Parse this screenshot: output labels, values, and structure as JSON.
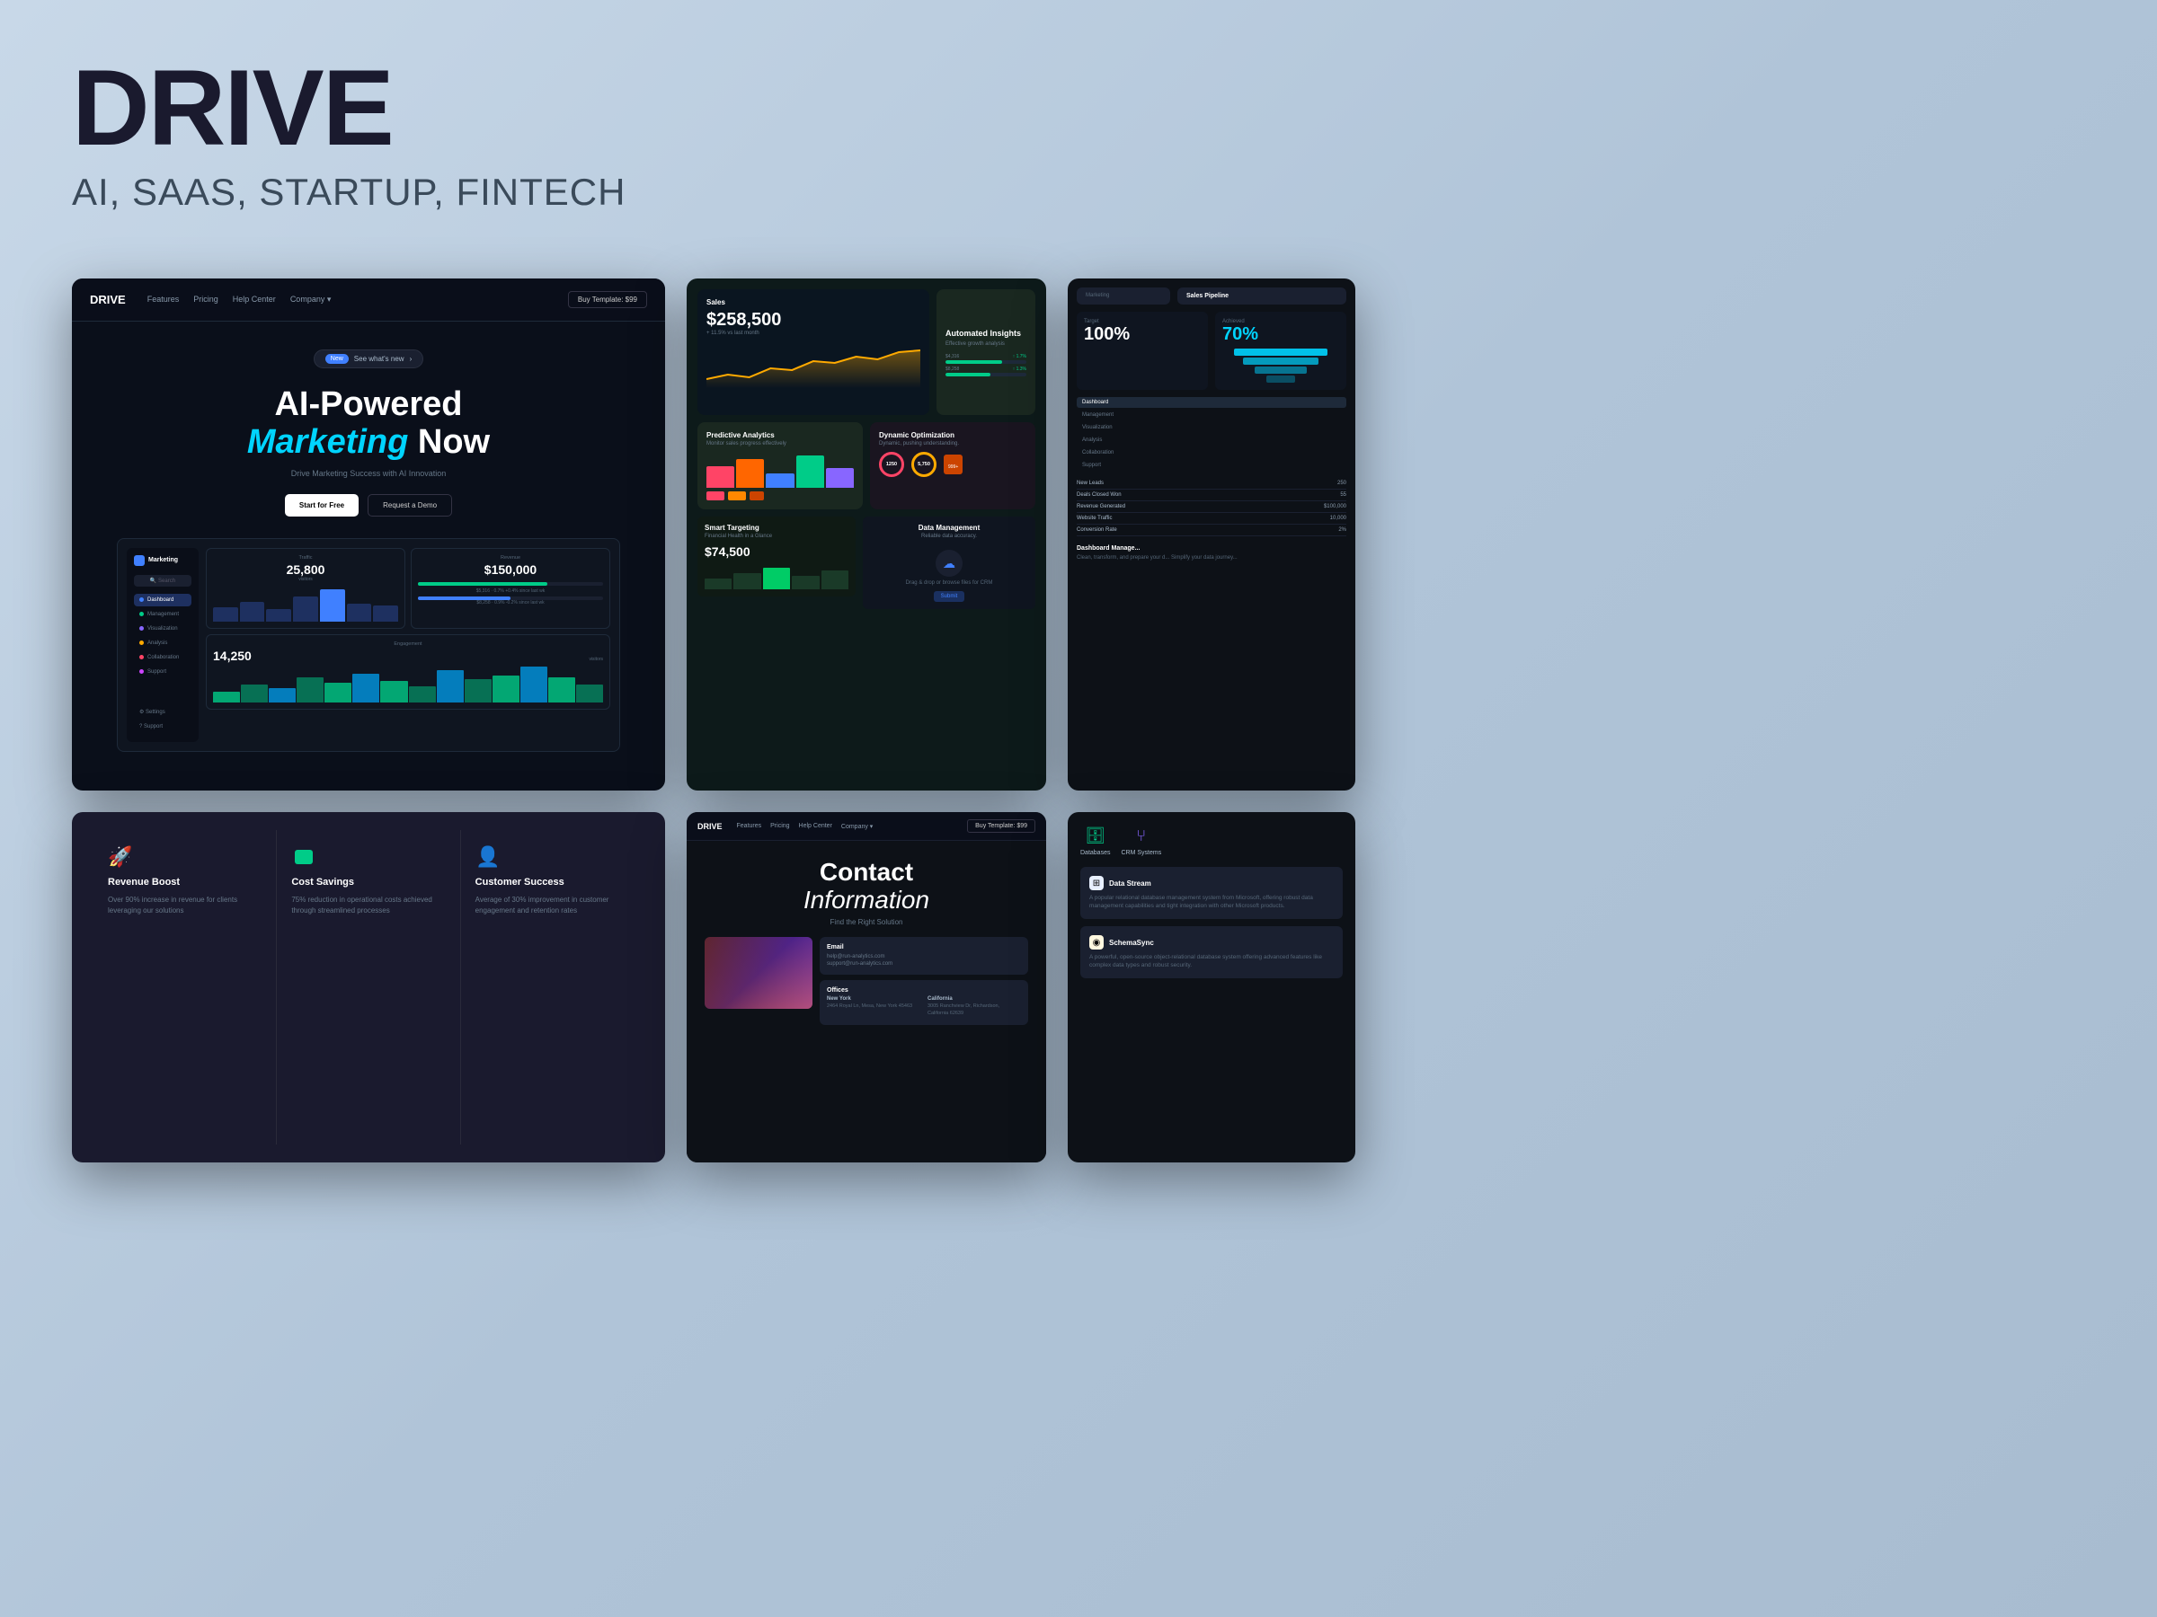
{
  "header": {
    "title": "DRIVE",
    "subtitle": "AI, SAAS, STARTUP, FINTECH"
  },
  "hero_card": {
    "logo": "DRIVE",
    "nav_links": [
      "Features",
      "Pricing",
      "Help Center",
      "Company"
    ],
    "buy_btn": "Buy Template: $99",
    "badge_new": "New",
    "badge_text": "See what's new",
    "heading_line1": "AI-Powered",
    "heading_line2": "Marketing Now",
    "subtext": "Drive Marketing Success with AI Innovation",
    "btn_primary": "Start for Free",
    "btn_secondary": "Request a Demo",
    "dashboard": {
      "logo": "D",
      "logo_text": "Marketing",
      "search_placeholder": "Search",
      "nav_items": [
        "Dashboard",
        "Management",
        "Visualization",
        "Analysis",
        "Collaboration",
        "Support"
      ],
      "traffic_label": "Traffic",
      "traffic_value": "25,800",
      "traffic_sub": "visitors",
      "revenue_label": "Revenue",
      "revenue_value": "$150,000",
      "engagement_label": "Engagement",
      "engagement_value": "14,250",
      "engagement_sub": "visitors"
    }
  },
  "analytics_card": {
    "sales_title": "Sales",
    "sales_value": "$258,500",
    "sales_sub": "+ 11.5% vs last month",
    "insights_title": "Automated Insights",
    "insights_sub": "Effective growth analysis",
    "insights_bars": [
      {
        "label": "$4,316",
        "pct": 70,
        "trend": "1.7% vs last week"
      },
      {
        "label": "$8,258",
        "pct": 55,
        "trend": "1.3% vs last week"
      }
    ],
    "predictive_title": "Predictive Analytics",
    "predictive_sub": "Monitor sales progress effectively",
    "dynamic_title": "Dynamic Optimization",
    "dynamic_sub": "Dynamic, pushing understanding.",
    "data_mgmt_title": "Data Management",
    "data_mgmt_sub": "Reliable data accuracy.",
    "smart_targeting_title": "Smart Targeting",
    "smart_targeting_sub": "Financial Health in a Glance",
    "smart_targeting_value": "$74,500",
    "upload_title": "Upload Files",
    "upload_sub": "Drag & drop or browse files for CRM"
  },
  "pipeline_card": {
    "marketing_label": "Marketing",
    "sales_pipeline_label": "Sales Pipeline",
    "pct_left": "100%",
    "pct_right": "70%",
    "nav_items": [
      "Dashboard",
      "Management",
      "Visualization",
      "Analysis",
      "Collaboration",
      "Support"
    ],
    "table_rows": [
      {
        "label": "New Leads",
        "value": "250"
      },
      {
        "label": "Deals Closed Won",
        "value": "55"
      },
      {
        "label": "Revenue Generated",
        "value": "$100,000"
      },
      {
        "label": "Website Traffic",
        "value": "10,000"
      },
      {
        "label": "Conversion Rate",
        "value": "2%"
      }
    ],
    "bottom_label": "Dashboard    Manage...",
    "bottom_sub": "Clean, transform, and prepare your d... Simplify your data journey..."
  },
  "contact_card": {
    "logo": "DRIVE",
    "nav_links": [
      "Features",
      "Pricing",
      "Help Center",
      "Company"
    ],
    "buy_btn": "Buy Template: $99",
    "heading": "Contact",
    "heading_italic": "Information",
    "sub": "Find the Right Solution",
    "email_label": "Email",
    "email_values": [
      "help@run-analytics.com",
      "support@run-analytics.com"
    ],
    "offices_label": "Offices",
    "office1_city": "New York",
    "office1_address": "2464 Royal Ln, Mesa, New York 45463",
    "office2_city": "California",
    "office2_address": "3005 Ranchview Dr, Richardson, California 62639"
  },
  "features_card": {
    "features": [
      {
        "icon": "rocket",
        "title": "Revenue Boost",
        "desc": "Over 90% increase in revenue for clients leveraging our solutions"
      },
      {
        "icon": "wallet",
        "title": "Cost Savings",
        "desc": "75% reduction in operational costs achieved through streamlined processes"
      },
      {
        "icon": "user",
        "title": "Customer Success",
        "desc": "Average of 30% improvement in customer engagement and retention rates"
      }
    ]
  },
  "databases_card": {
    "header_items": [
      "Databases",
      "CRM Systems"
    ],
    "items": [
      {
        "icon": "grid",
        "icon_color": "#0066cc",
        "name": "Data Stream",
        "desc": "A popular relational database management system from Microsoft, offering robust data management capabilities and tight integration with other Microsoft products."
      },
      {
        "icon": "circle",
        "icon_color": "#ff8800",
        "name": "SchemaSync",
        "desc": "A powerful, open-source object-relational database system offering advanced features like complex data types and robust security."
      }
    ]
  }
}
